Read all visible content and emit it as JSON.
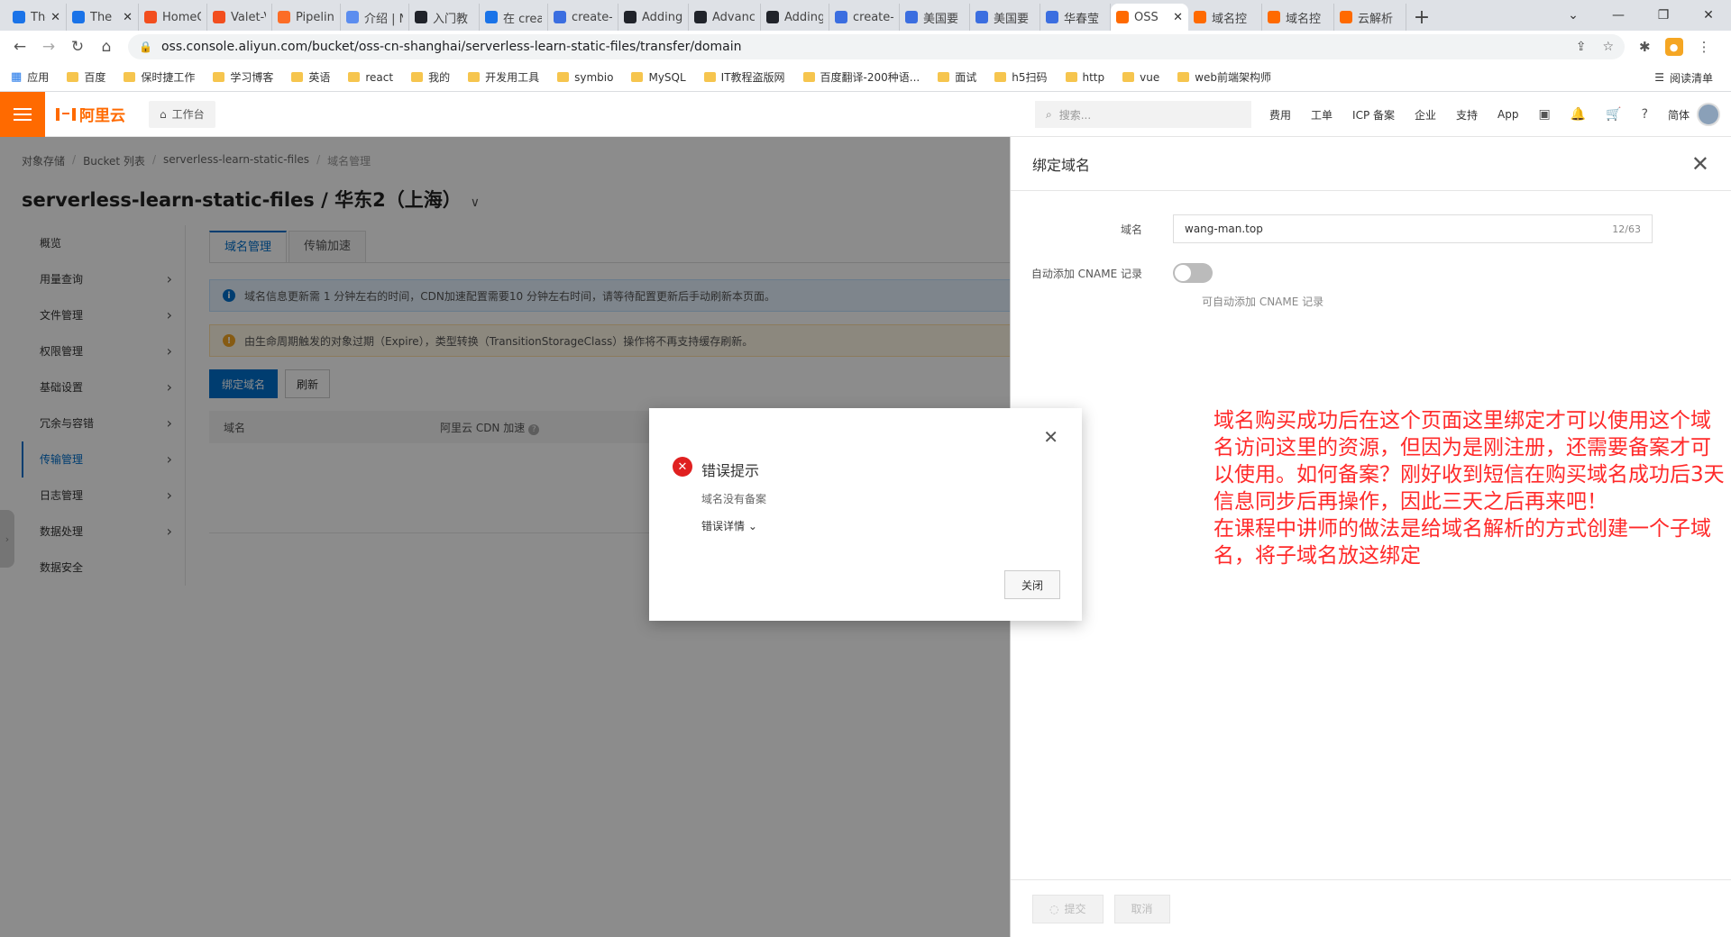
{
  "browser": {
    "tabs": [
      {
        "title": "The",
        "color": "#1a73e8",
        "width": 66
      },
      {
        "title": "The",
        "color": "#1a73e8",
        "width": 80
      },
      {
        "title": "HomeC",
        "color": "#f24e1e",
        "width": 76
      },
      {
        "title": "Valet-V",
        "color": "#f24e1e",
        "width": 72
      },
      {
        "title": "Pipelin",
        "color": "#fc6d26",
        "width": 76
      },
      {
        "title": "介绍 | N",
        "color": "#5b8def",
        "width": 76
      },
      {
        "title": "入门教",
        "color": "#20232a",
        "width": 78
      },
      {
        "title": "在 crea",
        "color": "#1a73e8",
        "width": 76
      },
      {
        "title": "create-",
        "color": "#3b6ee0",
        "width": 78
      },
      {
        "title": "Adding",
        "color": "#20232a",
        "width": 78
      },
      {
        "title": "Advanc",
        "color": "#20232a",
        "width": 80
      },
      {
        "title": "Adding",
        "color": "#20232a",
        "width": 76
      },
      {
        "title": "create-",
        "color": "#3b6ee0",
        "width": 78
      },
      {
        "title": "美国要",
        "color": "#3b6ee0",
        "width": 78
      },
      {
        "title": "美国要",
        "color": "#3b6ee0",
        "width": 78
      },
      {
        "title": "华春莹",
        "color": "#3b6ee0",
        "width": 78
      },
      {
        "title": "OSS",
        "color": "#ff6a00",
        "width": 86,
        "active": true
      },
      {
        "title": "域名控",
        "color": "#ff6a00",
        "width": 82
      },
      {
        "title": "域名控",
        "color": "#ff6a00",
        "width": 80
      },
      {
        "title": "云解析",
        "color": "#ff6a00",
        "width": 80
      }
    ],
    "url": "oss.console.aliyun.com/bucket/oss-cn-shanghai/serverless-learn-static-files/transfer/domain",
    "bookmarks_apps": "应用",
    "bookmarks": [
      "百度",
      "保时捷工作",
      "学习博客",
      "英语",
      "react",
      "我的",
      "开发用工具",
      "symbio",
      "MySQL",
      "IT教程盗版网",
      "百度翻译-200种语...",
      "面试",
      "h5扫码",
      "http",
      "vue",
      "web前端架构师"
    ],
    "reading_list": "阅读清单"
  },
  "topbar": {
    "logo": "阿里云",
    "workbench": "工作台",
    "search_placeholder": "搜索...",
    "links": [
      "费用",
      "工单",
      "ICP 备案",
      "企业",
      "支持",
      "App"
    ],
    "lang": "简体"
  },
  "page": {
    "breadcrumb": [
      "对象存储",
      "Bucket 列表",
      "serverless-learn-static-files",
      "域名管理"
    ],
    "title": "serverless-learn-static-files / 华东2（上海）",
    "sidenav": [
      {
        "label": "概览",
        "chev": false
      },
      {
        "label": "用量查询",
        "chev": true
      },
      {
        "label": "文件管理",
        "chev": true
      },
      {
        "label": "权限管理",
        "chev": true
      },
      {
        "label": "基础设置",
        "chev": true
      },
      {
        "label": "冗余与容错",
        "chev": true
      },
      {
        "label": "传输管理",
        "chev": true,
        "active": true
      },
      {
        "label": "日志管理",
        "chev": true
      },
      {
        "label": "数据处理",
        "chev": true
      },
      {
        "label": "数据安全",
        "chev": false
      }
    ],
    "tabs": [
      "域名管理",
      "传输加速"
    ],
    "notice_info": "域名信息更新需 1 分钟左右的时间，CDN加速配置需要10 分钟左右时间，请等待配置更新后手动刷新本页面。",
    "notice_warn": "由生命周期触发的对象过期（Expire），类型转换（TransitionStorageClass）操作将不再支持缓存刷新。",
    "bind_button": "绑定域名",
    "refresh_button": "刷新",
    "col_domain": "域名",
    "col_cdn": "阿里云 CDN 加速"
  },
  "drawer": {
    "title": "绑定域名",
    "domain_label": "域名",
    "domain_value": "wang-man.top",
    "domain_count": "12/63",
    "cname_label": "自动添加 CNAME 记录",
    "cname_help": "可自动添加 CNAME 记录",
    "submit": "提交",
    "cancel": "取消",
    "annotation": "域名购买成功后在这个页面这里绑定才可以使用这个域名访问这里的资源，但因为是刚注册，还需要备案才可以使用。如何备案？刚好收到短信在购买域名成功后3天信息同步后再操作，因此三天之后再来吧！\n在课程中讲师的做法是给域名解析的方式创建一个子域名，将子域名放这绑定"
  },
  "modal": {
    "title": "错误提示",
    "message": "域名没有备案",
    "detail": "错误详情",
    "close": "关闭"
  }
}
